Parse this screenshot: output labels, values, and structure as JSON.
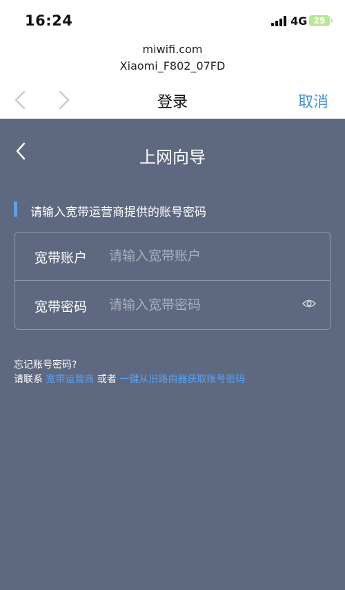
{
  "status_bar": {
    "time": "16:24",
    "network": "4G",
    "battery": "29"
  },
  "browser": {
    "url": "miwifi.com",
    "ssid": "Xiaomi_F802_07FD",
    "title": "登录",
    "cancel": "取消"
  },
  "wizard": {
    "title": "上网向导",
    "section_label": "请输入宽带运营商提供的账号密码",
    "account": {
      "label": "宽带账户",
      "placeholder": "请输入宽带账户",
      "value": ""
    },
    "password": {
      "label": "宽带密码",
      "placeholder": "请输入宽带密码",
      "value": ""
    },
    "help": {
      "forgot": "忘记账号密码?",
      "prefix": "请联系",
      "isp_link": "宽带运营商",
      "or": "或者",
      "old_router_link": "一键从旧路由器获取账号密码"
    }
  },
  "colors": {
    "accent": "#3e8fe0",
    "link": "#5aa2f0",
    "panel_bg": "#5e6880",
    "battery": "#b9e98e"
  },
  "icons": [
    "signal-icon",
    "battery-icon",
    "nav-back-icon",
    "nav-forward-icon",
    "back-chevron-icon",
    "eye-icon"
  ]
}
